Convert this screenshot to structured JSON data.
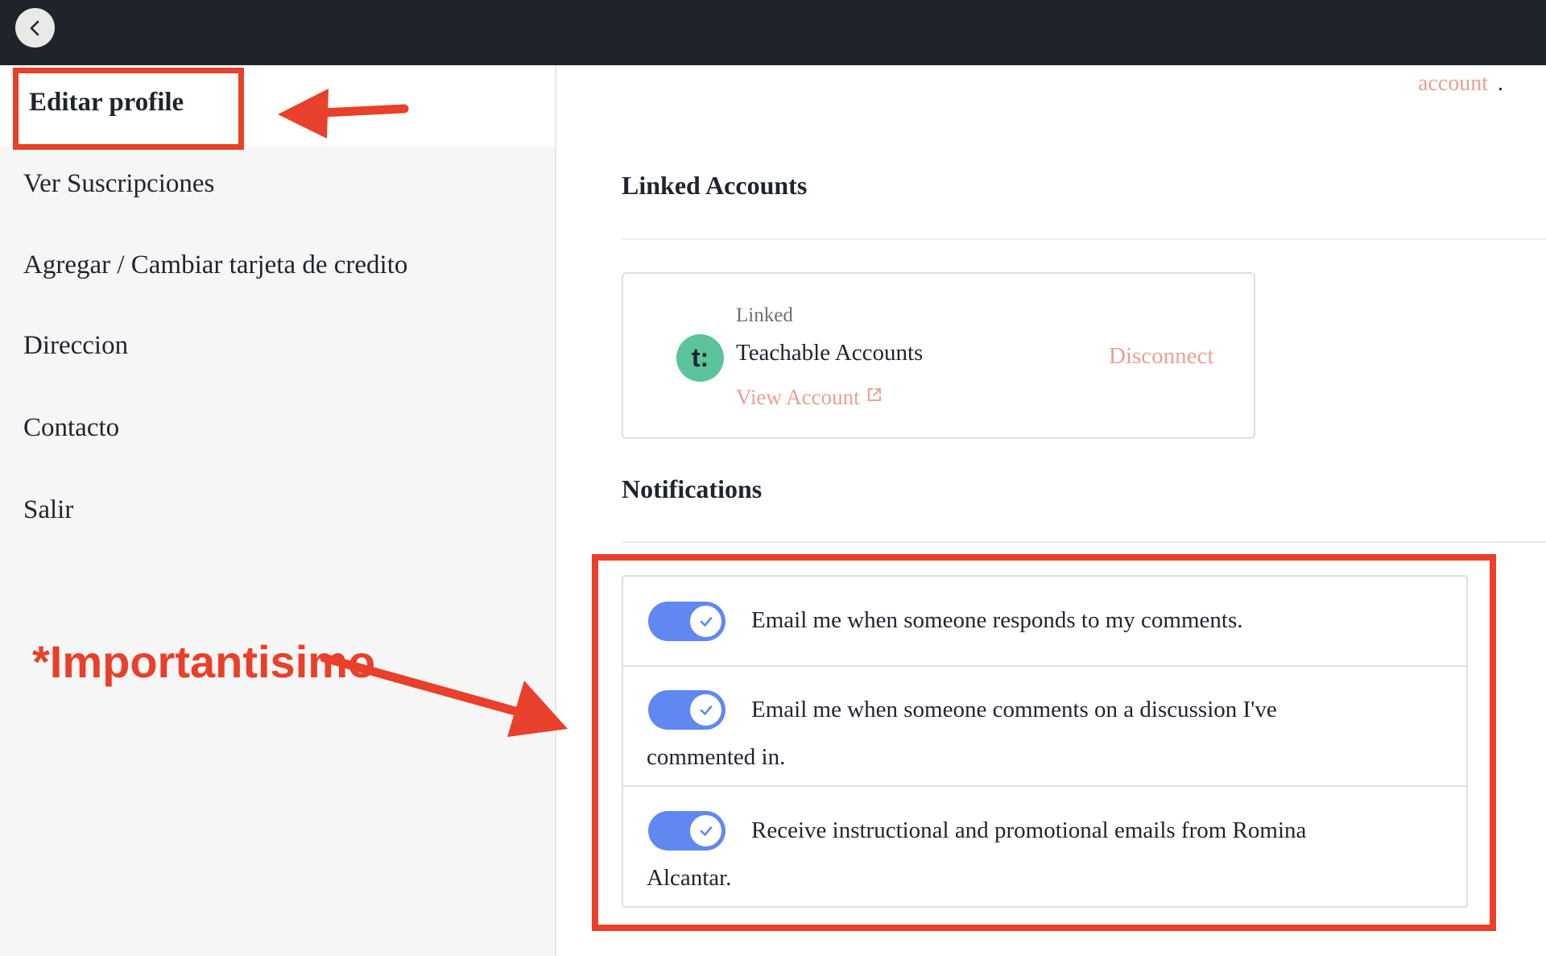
{
  "topbar": {
    "back_icon": "chevron-left-icon"
  },
  "sidebar": {
    "items": [
      {
        "label": "Editar profile",
        "active": true
      },
      {
        "label": "Ver Suscripciones"
      },
      {
        "label": "Agregar / Cambiar tarjeta de credito"
      },
      {
        "label": "Direccion"
      },
      {
        "label": "Contacto"
      },
      {
        "label": "Salir"
      }
    ],
    "annotation": "*Importantisimo"
  },
  "main": {
    "account_link": "account",
    "account_period": ".",
    "linked_accounts": {
      "title": "Linked Accounts",
      "card": {
        "status": "Linked",
        "avatar_text": "t:",
        "name": "Teachable Accounts",
        "view_link": "View Account",
        "view_icon": "external-link-icon",
        "disconnect": "Disconnect"
      }
    },
    "notifications": {
      "title": "Notifications",
      "items": [
        {
          "text": "Email me when someone responds to my comments.",
          "enabled": true
        },
        {
          "text": "Email me when someone comments on a discussion I've commented in.",
          "enabled": true
        },
        {
          "text": "Receive instructional and promotional emails from Romina Alcantar.",
          "enabled": true
        }
      ]
    }
  },
  "colors": {
    "topbar": "#1f242b",
    "accent_link": "#e8a196",
    "toggle_on": "#6088f0",
    "annotation_red": "#e8402a",
    "avatar": "#5cc49a"
  }
}
